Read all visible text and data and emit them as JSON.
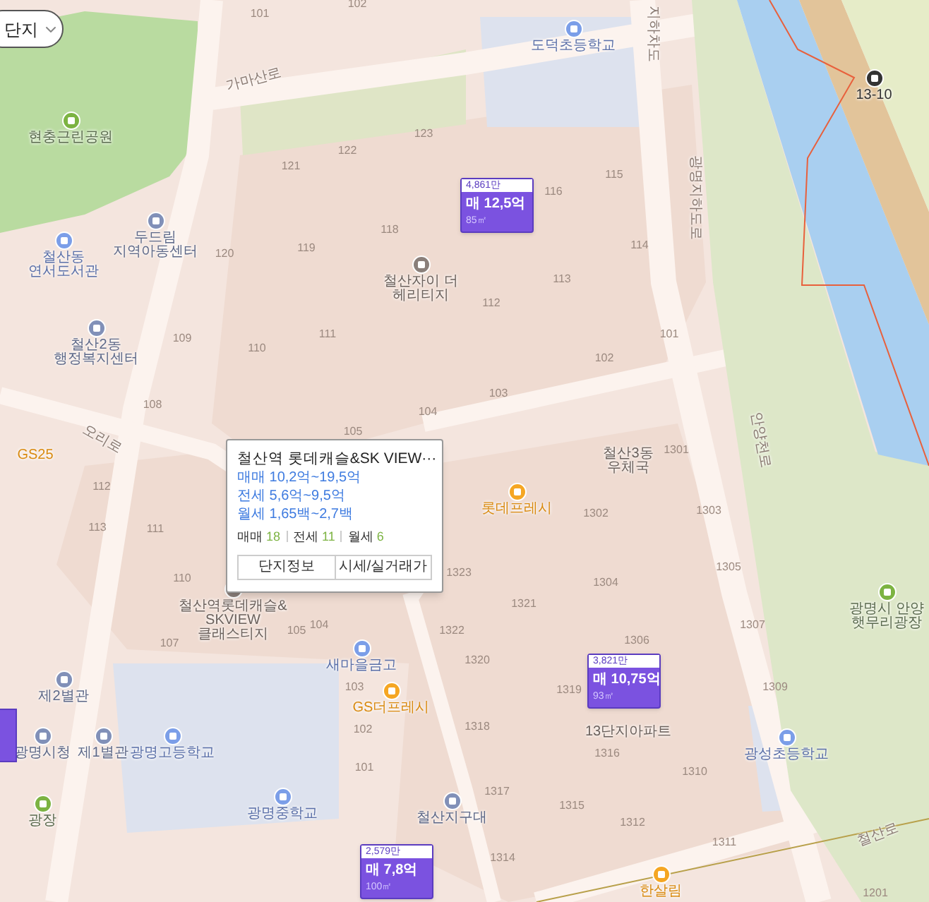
{
  "filter_button": {
    "label": "단지"
  },
  "map": {
    "places": [
      {
        "lines": [
          "현충근린공원"
        ],
        "kind": "park"
      },
      {
        "lines": [
          "두드림",
          "지역아동센터"
        ],
        "kind": "office"
      },
      {
        "lines": [
          "철산동",
          "연서도서관"
        ],
        "kind": "library"
      },
      {
        "lines": [
          "철산2동",
          "행정복지센터"
        ],
        "kind": "office"
      },
      {
        "lines": [
          "철산자이 더",
          "헤리티지"
        ],
        "kind": "apartment"
      },
      {
        "lines": [
          "도덕초등학교"
        ],
        "kind": "school"
      },
      {
        "lines": [
          "13-10"
        ],
        "kind": "transit"
      },
      {
        "lines": [
          "GS25"
        ],
        "kind": "store"
      },
      {
        "lines": [
          "철산3동",
          "우체국"
        ],
        "kind": "label"
      },
      {
        "lines": [
          "롯데프레시"
        ],
        "kind": "shop"
      },
      {
        "lines": [
          "철산역롯데캐슬&",
          "SKVIEW",
          "클래스티지"
        ],
        "kind": "apartment"
      },
      {
        "lines": [
          "새마을금고"
        ],
        "kind": "bank"
      },
      {
        "lines": [
          "GS더프레시"
        ],
        "kind": "shop"
      },
      {
        "lines": [
          "제2별관"
        ],
        "kind": "office"
      },
      {
        "lines": [
          "광명시청"
        ],
        "kind": "office"
      },
      {
        "lines": [
          "제1별관"
        ],
        "kind": "office"
      },
      {
        "lines": [
          "광명고등학교"
        ],
        "kind": "school"
      },
      {
        "lines": [
          "광명중학교"
        ],
        "kind": "school"
      },
      {
        "lines": [
          "광장"
        ],
        "kind": "park"
      },
      {
        "lines": [
          "철산지구대"
        ],
        "kind": "office"
      },
      {
        "lines": [
          "13단지아파트"
        ],
        "kind": "label"
      },
      {
        "lines": [
          "광성초등학교"
        ],
        "kind": "school"
      },
      {
        "lines": [
          "광명시 안양",
          "햇무리광장"
        ],
        "kind": "park"
      },
      {
        "lines": [
          "한살림"
        ],
        "kind": "shop"
      }
    ],
    "roads": [
      "가마산로",
      "오리로",
      "지하차도",
      "광명지하도로",
      "안양천로",
      "철산로"
    ],
    "building_numbers": [
      "101",
      "102",
      "123",
      "122",
      "121",
      "118",
      "119",
      "120",
      "116",
      "115",
      "114",
      "113",
      "112",
      "111",
      "110",
      "109",
      "108",
      "104",
      "105",
      "103",
      "102",
      "101",
      "112",
      "113",
      "111",
      "110",
      "107",
      "105",
      "104",
      "103",
      "102",
      "101",
      "1323",
      "1322",
      "1301",
      "1302",
      "1303",
      "1304",
      "1305",
      "1321",
      "1306",
      "1307",
      "1320",
      "1319",
      "1309",
      "1318",
      "1316",
      "1310",
      "1317",
      "1315",
      "1312",
      "1311",
      "1314",
      "1201"
    ]
  },
  "markers": [
    {
      "unit_price": "4,861만",
      "price": "매 12,5억",
      "area": "85㎡"
    },
    {
      "unit_price": "3,821만",
      "price": "매 10,75억",
      "area": "93㎡"
    },
    {
      "unit_price": "2,579만",
      "price": "매 7,8억",
      "area": "100㎡"
    }
  ],
  "popup": {
    "title": "철산역 롯데캐슬&SK VIEW···",
    "ranges": [
      "매매 10,2억~19,5억",
      "전세 5,6억~9,5억",
      "월세 1,65백~2,7백"
    ],
    "counts": [
      {
        "label": "매매",
        "count": "18"
      },
      {
        "label": "전세",
        "count": "11"
      },
      {
        "label": "월세",
        "count": "6"
      }
    ],
    "buttons": [
      "단지정보",
      "시세/실거래가"
    ]
  }
}
